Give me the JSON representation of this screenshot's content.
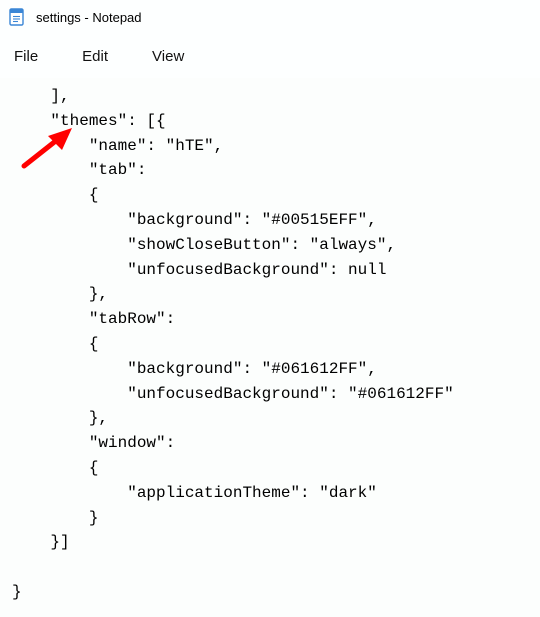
{
  "window": {
    "title": "settings - Notepad"
  },
  "menu": {
    "file": "File",
    "edit": "Edit",
    "view": "View"
  },
  "content": "    ],\n    \"themes\": [{\n        \"name\": \"hTE\",\n        \"tab\":\n        {\n            \"background\": \"#00515EFF\",\n            \"showCloseButton\": \"always\",\n            \"unfocusedBackground\": null\n        },\n        \"tabRow\":\n        {\n            \"background\": \"#061612FF\",\n            \"unfocusedBackground\": \"#061612FF\"\n        },\n        \"window\":\n        {\n            \"applicationTheme\": \"dark\"\n        }\n    }]\n\n}"
}
